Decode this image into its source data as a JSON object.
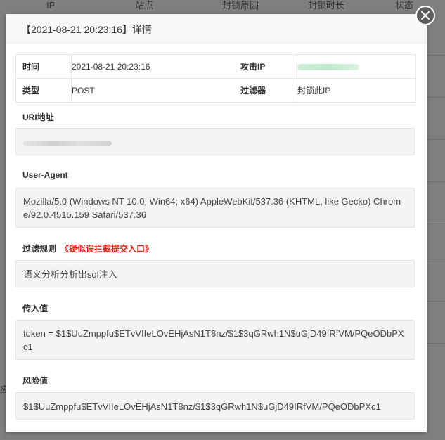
{
  "background": {
    "columns": [
      "IP",
      "站点",
      "封锁原因",
      "封锁时长",
      "状态"
    ],
    "side_char": "应"
  },
  "modal": {
    "title": "【2021-08-21 20:23:16】详情",
    "close_icon": "close-icon"
  },
  "info": {
    "time_label": "时间",
    "time_value": "2021-08-21 20:23:16",
    "attack_ip_label": "攻击IP",
    "attack_ip_value": "",
    "type_label": "类型",
    "type_value": "POST",
    "filter_label": "过滤器",
    "filter_value": "封锁此IP"
  },
  "uri": {
    "label": "URI地址",
    "value": ""
  },
  "user_agent": {
    "label": "User-Agent",
    "value": "Mozilla/5.0 (Windows NT 10.0; Win64; x64) AppleWebKit/537.36 (KHTML, like Gecko) Chrome/92.0.4515.159 Safari/537.36"
  },
  "filter_rule": {
    "label": "过滤规则",
    "warning": "《疑似误拦截提交入口》",
    "value": "语义分析分析出sql注入"
  },
  "input_value": {
    "label": "传入值",
    "value": "token = $1$UuZmppfu$ETvVIIeLOvEHjAsN1T8nz/$1$3qGRwh1N$uGjD49IRfVM/PQeODbPXc1"
  },
  "risk_value": {
    "label": "风险值",
    "value": "$1$UuZmppfu$ETvVIIeLOvEHjAsN1T8nz/$1$3qGRwh1N$uGjD49IRfVM/PQeODbPXc1"
  },
  "colors": {
    "warning": "#e62117",
    "overlay": "#7f7f7f"
  }
}
